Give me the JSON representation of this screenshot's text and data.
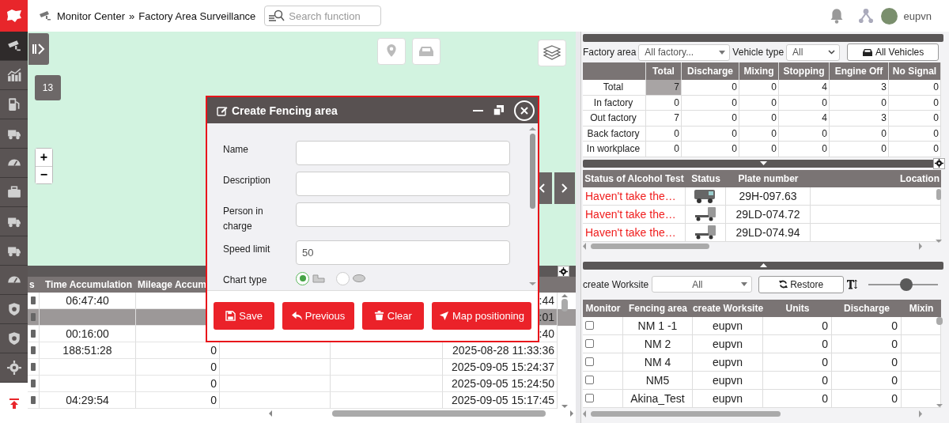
{
  "topbar": {
    "breadcrumb": [
      "Monitor Center",
      "»",
      "Factory Area Surveillance"
    ],
    "search": {
      "placeholder": "Search function"
    },
    "user": "eupvn"
  },
  "sidebar": {
    "items": [
      {
        "selected": true
      },
      {
        "selected": false
      },
      {
        "selected": false
      },
      {
        "selected": false
      },
      {
        "selected": false
      },
      {
        "selected": false
      },
      {
        "selected": false
      },
      {
        "selected": false
      },
      {
        "selected": false
      },
      {
        "selected": false
      },
      {
        "selected": false
      },
      {
        "selected": false
      }
    ]
  },
  "map": {
    "zoom_badge": "13",
    "zoom_in": "+",
    "zoom_out": "−"
  },
  "vehicle_table": {
    "columns": [
      "s",
      "Time Accumulation",
      "Mileage Accum"
    ],
    "rows": [
      {
        "selected": false,
        "cells": [
          "",
          "06:47:40",
          "",
          "",
          "",
          ":44"
        ]
      },
      {
        "selected": true,
        "cells": [
          "",
          "",
          "",
          "",
          "",
          ":01"
        ]
      },
      {
        "selected": false,
        "cells": [
          "",
          "00:16:00",
          "",
          "",
          "",
          ":40"
        ]
      },
      {
        "selected": false,
        "cells": [
          "",
          "188:51:28",
          "0",
          "",
          "",
          "2025-08-28 11:33:36"
        ]
      },
      {
        "selected": false,
        "cells": [
          "",
          "",
          "0",
          "",
          "",
          "2025-09-05 15:24:37"
        ]
      },
      {
        "selected": false,
        "cells": [
          "",
          "",
          "0",
          "",
          "",
          "2025-09-05 15:24:50"
        ]
      },
      {
        "selected": false,
        "cells": [
          "",
          "04:29:54",
          "0",
          "",
          "",
          "2025-09-05 15:17:45"
        ]
      }
    ]
  },
  "dialog": {
    "title": "Create Fencing area",
    "fields": [
      {
        "label": "Name"
      },
      {
        "label": "Description"
      },
      {
        "label": "Person in charge"
      },
      {
        "label": "Speed limit",
        "value": "50"
      }
    ],
    "chart_type": {
      "label": "Chart type",
      "options": [
        {
          "kind": "polygon",
          "selected": true
        },
        {
          "kind": "ellipse",
          "selected": false
        }
      ]
    },
    "buttons": [
      {
        "kind": "save",
        "label": "Save"
      },
      {
        "kind": "previous",
        "label": "Previous"
      },
      {
        "kind": "clear",
        "label": "Clear"
      },
      {
        "kind": "locate",
        "label": "Map positioning"
      }
    ]
  },
  "stats": {
    "filters": {
      "factory_area": {
        "label": "Factory area",
        "value": "All factory..."
      },
      "vehicle_type": {
        "label": "Vehicle type",
        "value": "All"
      },
      "all_vehicles_button": "All Vehicles"
    },
    "columns": [
      "Total",
      "Discharge",
      "Mixing",
      "Stopping",
      "Engine Off",
      "No Signal"
    ],
    "rows": [
      {
        "label": "Total",
        "total_selected": true,
        "values": [
          "7",
          "0",
          "0",
          "4",
          "3",
          "0"
        ]
      },
      {
        "label": "In factory",
        "total_selected": false,
        "values": [
          "0",
          "0",
          "0",
          "0",
          "0",
          "0"
        ]
      },
      {
        "label": "Out factory",
        "total_selected": false,
        "values": [
          "7",
          "0",
          "0",
          "4",
          "3",
          "0"
        ]
      },
      {
        "label": "Back factory",
        "total_selected": false,
        "values": [
          "0",
          "0",
          "0",
          "0",
          "0",
          "0"
        ]
      },
      {
        "label": "In workplace",
        "total_selected": false,
        "values": [
          "0",
          "0",
          "0",
          "0",
          "0",
          "0"
        ]
      }
    ]
  },
  "alcohol_table": {
    "columns": [
      "Status of Alcohol Test",
      "Status",
      "Plate number",
      "Location"
    ],
    "rows": [
      {
        "alcohol_status": "Haven't take the…",
        "kind": "van",
        "plate": "29H-097.63"
      },
      {
        "alcohol_status": "Haven't take the…",
        "kind": "tractor",
        "plate": "29LD-074.72"
      },
      {
        "alcohol_status": "Haven't take the…",
        "kind": "tractor",
        "plate": "29LD-074.94"
      }
    ]
  },
  "fencing": {
    "worksite_filter": {
      "label": "create Worksite",
      "value": "All"
    },
    "restore_button": "Restore",
    "font_size_slider": {
      "level": 0.55
    },
    "columns": [
      "Monitor",
      "Fencing area",
      "create Worksite",
      "Units",
      "Discharge",
      "Mixin"
    ],
    "rows": [
      {
        "checked": false,
        "name": "NM 1 -1",
        "worksite": "eupvn",
        "units": "0",
        "discharge": "0"
      },
      {
        "checked": false,
        "name": "NM 2",
        "worksite": "eupvn",
        "units": "0",
        "discharge": "0"
      },
      {
        "checked": false,
        "name": "NM 4",
        "worksite": "eupvn",
        "units": "0",
        "discharge": "0"
      },
      {
        "checked": false,
        "name": "NM5",
        "worksite": "eupvn",
        "units": "0",
        "discharge": "0"
      },
      {
        "checked": false,
        "name": "Akina_Test",
        "worksite": "eupvn",
        "units": "0",
        "discharge": "0"
      }
    ]
  }
}
